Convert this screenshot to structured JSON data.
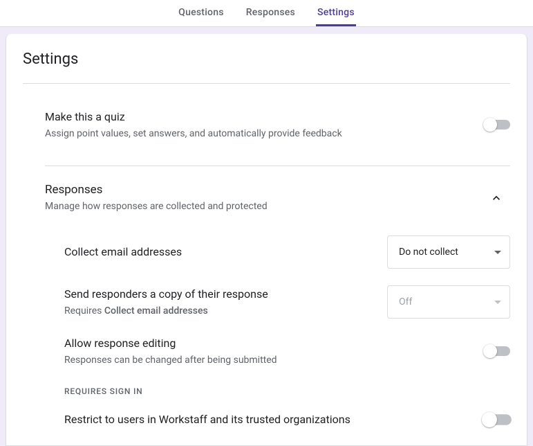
{
  "tabs": {
    "questions": "Questions",
    "responses": "Responses",
    "settings": "Settings"
  },
  "page_title": "Settings",
  "quiz": {
    "title": "Make this a quiz",
    "sub": "Assign point values, set answers, and automatically provide feedback"
  },
  "responses_group": {
    "title": "Responses",
    "sub": "Manage how responses are collected and protected"
  },
  "collect": {
    "title": "Collect email addresses",
    "value": "Do not collect"
  },
  "sendcopy": {
    "title": "Send responders a copy of their response",
    "sub_prefix": "Requires ",
    "sub_bold": "Collect email addresses",
    "value": "Off"
  },
  "allow_edit": {
    "title": "Allow response editing",
    "sub": "Responses can be changed after being submitted"
  },
  "requires_signin_label": "REQUIRES SIGN IN",
  "restrict": {
    "title": "Restrict to users in Workstaff and its trusted organizations"
  }
}
